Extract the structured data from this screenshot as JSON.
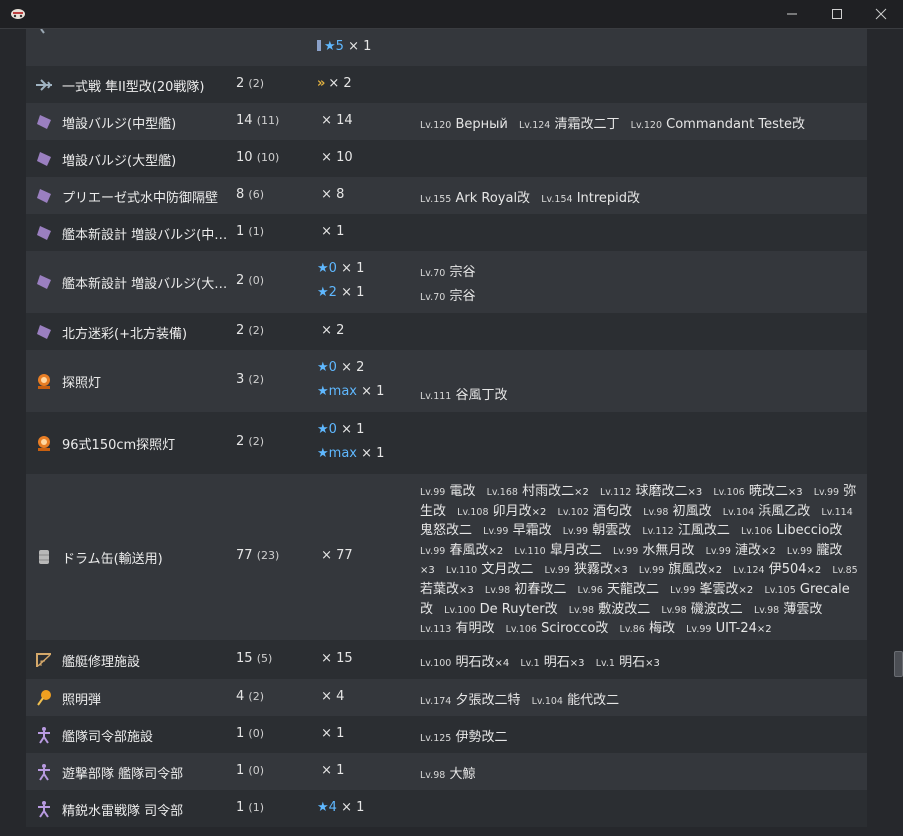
{
  "window": {
    "icon": "app-logo-icon",
    "controls": [
      "minimize-icon",
      "maximize-icon",
      "close-icon"
    ]
  },
  "top_partial": {
    "stars": "★5",
    "count": "× 1"
  },
  "rows": [
    {
      "icon": "plane-icon",
      "name": "一式戦 隼II型改(20戦隊)",
      "total": "2",
      "unused": "(2)",
      "levels": [
        {
          "prefix": "»",
          "star": "",
          "count": "× 2"
        }
      ],
      "ships": []
    },
    {
      "icon": "bulge-icon",
      "name": "増設バルジ(中型艦)",
      "total": "14",
      "unused": "(11)",
      "levels": [
        {
          "star": "",
          "count": "× 14"
        }
      ],
      "ships": [
        {
          "lv": "Lv.120",
          "name": "Верный"
        },
        {
          "lv": "Lv.124",
          "name": "清霜改二丁"
        },
        {
          "lv": "Lv.120",
          "name": "Commandant Teste改"
        }
      ]
    },
    {
      "icon": "bulge-icon",
      "name": "増設バルジ(大型艦)",
      "total": "10",
      "unused": "(10)",
      "levels": [
        {
          "star": "",
          "count": "× 10"
        }
      ],
      "ships": []
    },
    {
      "icon": "bulge-icon",
      "name": "プリエーゼ式水中防御隔壁",
      "total": "8",
      "unused": "(6)",
      "levels": [
        {
          "star": "",
          "count": "× 8"
        }
      ],
      "ships": [
        {
          "lv": "Lv.155",
          "name": "Ark Royal改"
        },
        {
          "lv": "Lv.154",
          "name": "Intrepid改"
        }
      ]
    },
    {
      "icon": "bulge-icon",
      "name": "艦本新設計 増設バルジ(中型艦)",
      "total": "1",
      "unused": "(1)",
      "levels": [
        {
          "star": "",
          "count": "× 1"
        }
      ],
      "ships": []
    },
    {
      "icon": "bulge-icon",
      "name": "艦本新設計 増設バルジ(大型艦)",
      "total": "2",
      "unused": "(0)",
      "levels": [
        {
          "star": "★0",
          "count": "× 1",
          "ship": {
            "lv": "Lv.70",
            "name": "宗谷"
          }
        },
        {
          "star": "★2",
          "count": "× 1",
          "ship": {
            "lv": "Lv.70",
            "name": "宗谷"
          }
        }
      ],
      "ships": []
    },
    {
      "icon": "bulge-icon",
      "name": "北方迷彩(+北方装備)",
      "total": "2",
      "unused": "(2)",
      "levels": [
        {
          "star": "",
          "count": "× 2"
        }
      ],
      "ships": []
    },
    {
      "icon": "searchlight-icon",
      "name": "探照灯",
      "total": "3",
      "unused": "(2)",
      "levels": [
        {
          "star": "★0",
          "count": "× 2"
        },
        {
          "star": "★max",
          "count": "× 1",
          "ship": {
            "lv": "Lv.111",
            "name": "谷風丁改"
          }
        }
      ],
      "ships": []
    },
    {
      "icon": "searchlight-icon",
      "name": "96式150cm探照灯",
      "total": "2",
      "unused": "(2)",
      "levels": [
        {
          "star": "★0",
          "count": "× 1"
        },
        {
          "star": "★max",
          "count": "× 1"
        }
      ],
      "ships": []
    },
    {
      "icon": "drum-icon",
      "name": "ドラム缶(輸送用)",
      "total": "77",
      "unused": "(23)",
      "levels": [
        {
          "star": "",
          "count": "× 77"
        }
      ],
      "ships_multi": [
        {
          "lv": "Lv.99",
          "name": "電改"
        },
        {
          "lv": "Lv.168",
          "name": "村雨改二",
          "x": "×2"
        },
        {
          "lv": "Lv.112",
          "name": "球磨改二",
          "x": "×3"
        },
        {
          "lv": "Lv.106",
          "name": "暁改二",
          "x": "×3"
        },
        {
          "lv": "Lv.99",
          "name": "弥生改"
        },
        {
          "lv": "Lv.108",
          "name": "卯月改",
          "x": "×2"
        },
        {
          "lv": "Lv.102",
          "name": "酒匂改"
        },
        {
          "lv": "Lv.98",
          "name": "初風改"
        },
        {
          "lv": "Lv.104",
          "name": "浜風乙改"
        },
        {
          "lv": "Lv.114",
          "name": "鬼怒改二"
        },
        {
          "lv": "Lv.99",
          "name": "早霜改"
        },
        {
          "lv": "Lv.99",
          "name": "朝雲改"
        },
        {
          "lv": "Lv.112",
          "name": "江風改二"
        },
        {
          "lv": "Lv.106",
          "name": "Libeccio改"
        },
        {
          "lv": "Lv.99",
          "name": "春風改",
          "x": "×2"
        },
        {
          "lv": "Lv.110",
          "name": "皐月改二"
        },
        {
          "lv": "Lv.99",
          "name": "水無月改"
        },
        {
          "lv": "Lv.99",
          "name": "漣改",
          "x": "×2"
        },
        {
          "lv": "Lv.99",
          "name": "朧改",
          "x": "×3"
        },
        {
          "lv": "Lv.110",
          "name": "文月改二"
        },
        {
          "lv": "Lv.99",
          "name": "狭霧改",
          "x": "×3"
        },
        {
          "lv": "Lv.99",
          "name": "旗風改",
          "x": "×2"
        },
        {
          "lv": "Lv.124",
          "name": "伊504",
          "x": "×2"
        },
        {
          "lv": "Lv.85",
          "name": "若葉改",
          "x": "×3"
        },
        {
          "lv": "Lv.98",
          "name": "初春改二"
        },
        {
          "lv": "Lv.96",
          "name": "天龍改二"
        },
        {
          "lv": "Lv.99",
          "name": "峯雲改",
          "x": "×2"
        },
        {
          "lv": "Lv.105",
          "name": "Grecale改"
        },
        {
          "lv": "Lv.100",
          "name": "De Ruyter改"
        },
        {
          "lv": "Lv.98",
          "name": "敷波改二"
        },
        {
          "lv": "Lv.98",
          "name": "磯波改二"
        },
        {
          "lv": "Lv.98",
          "name": "薄雲改"
        },
        {
          "lv": "Lv.113",
          "name": "有明改"
        },
        {
          "lv": "Lv.106",
          "name": "Scirocco改"
        },
        {
          "lv": "Lv.86",
          "name": "梅改"
        },
        {
          "lv": "Lv.99",
          "name": "UIT-24",
          "x": "×2"
        }
      ]
    },
    {
      "icon": "repair-facility-icon",
      "name": "艦艇修理施設",
      "total": "15",
      "unused": "(5)",
      "levels": [
        {
          "star": "",
          "count": "× 15"
        }
      ],
      "ships": [
        {
          "lv": "Lv.100",
          "name": "明石改",
          "x": "×4"
        },
        {
          "lv": "Lv.1",
          "name": "明石",
          "x": "×3"
        },
        {
          "lv": "Lv.1",
          "name": "明石",
          "x": "×3"
        }
      ]
    },
    {
      "icon": "flare-icon",
      "name": "照明弾",
      "total": "4",
      "unused": "(2)",
      "levels": [
        {
          "star": "",
          "count": "× 4"
        }
      ],
      "ships": [
        {
          "lv": "Lv.174",
          "name": "夕張改二特"
        },
        {
          "lv": "Lv.104",
          "name": "能代改二"
        }
      ]
    },
    {
      "icon": "command-facility-icon",
      "name": "艦隊司令部施設",
      "total": "1",
      "unused": "(0)",
      "levels": [
        {
          "star": "",
          "count": "× 1"
        }
      ],
      "ships": [
        {
          "lv": "Lv.125",
          "name": "伊勢改二"
        }
      ]
    },
    {
      "icon": "command-facility-icon",
      "name": "遊撃部隊 艦隊司令部",
      "total": "1",
      "unused": "(0)",
      "levels": [
        {
          "star": "",
          "count": "× 1"
        }
      ],
      "ships": [
        {
          "lv": "Lv.98",
          "name": "大鯨"
        }
      ]
    },
    {
      "icon": "command-facility-icon",
      "name": "精鋭水雷戦隊 司令部",
      "total": "1",
      "unused": "(1)",
      "levels": [
        {
          "star": "★4",
          "count": "× 1"
        }
      ],
      "ships": []
    }
  ]
}
